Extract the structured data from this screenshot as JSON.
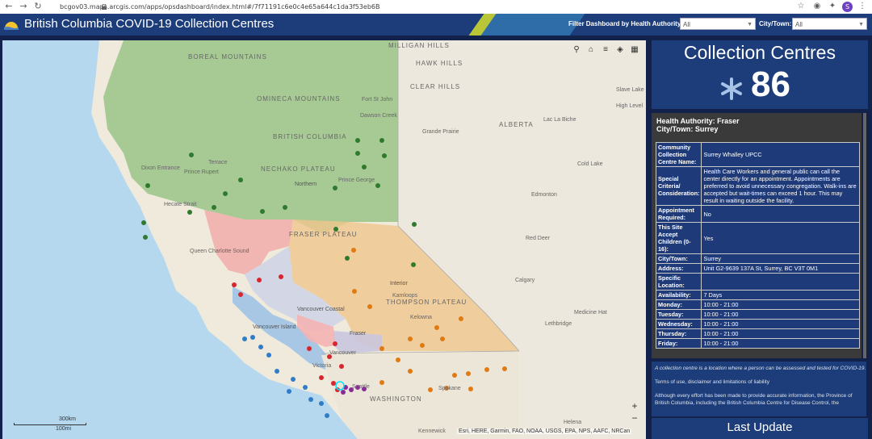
{
  "browser": {
    "url": "bcgov03.maps.arcgis.com/apps/opsdashboard/index.html#/7f71191c6e0c4e65a644c1da3f53eb6B",
    "profile_initial": "S"
  },
  "header": {
    "title": "British Columbia COVID-19 Collection Centres",
    "filter_label": "Filter Dashboard by Health Authority:",
    "filter_value": "All",
    "city_label": "City/Town:",
    "city_value": "All"
  },
  "map": {
    "labels": [
      "BOREAL MOUNTAINS",
      "OMINECA MOUNTAINS",
      "BRITISH COLUMBIA",
      "NECHAKO PLATEAU",
      "FRASER PLATEAU",
      "THOMPSON PLATEAU",
      "Vancouver Coastal",
      "Vancouver Island",
      "Fraser",
      "Interior",
      "Northern",
      "Fort St John",
      "Dawson Creek",
      "Prince George",
      "Terrace",
      "Prince Rupert",
      "Dixon Entrance",
      "Hecate Strait",
      "Queen Charlotte Sound",
      "Grande Prairie",
      "ALBERTA",
      "Edmonton",
      "Red Deer",
      "Calgary",
      "Lethbridge",
      "Medicine Hat",
      "Kamloops",
      "Kelowna",
      "Vancouver",
      "Victoria",
      "Seattle",
      "Spokane",
      "WASHINGTON",
      "Cold Lake",
      "Lac La Biche",
      "Slave Lake",
      "High Level",
      "Kennewick",
      "Helena",
      "CLEAR HILLS",
      "HAWK HILLS",
      "MILLIGAN HILLS"
    ],
    "attribution": "Esri, HERE, Garmin, FAO, NOAA, USGS, EPA, NPS, AAFC, NRCan",
    "scale_km": "300km",
    "scale_mi": "100mi",
    "tools": [
      "search-icon",
      "home-icon",
      "list-icon",
      "layers-icon",
      "grid-icon"
    ]
  },
  "kpi": {
    "title": "Collection Centres",
    "value": "86",
    "icon": "asterisk-icon"
  },
  "details": {
    "health_authority": "Health Authority: Fraser",
    "city_town": "City/Town: Surrey",
    "rows": [
      {
        "key": "Community Collection Centre Name:",
        "value": "Surrey Whalley UPCC"
      },
      {
        "key": "Special Criteria/ Consideration:",
        "value": "Health Care Workers and general public can call the center directly for an appointment. Appointments are preferred to avoid unnecessary congregation. Walk-ins are accepted but wait-times can exceed 1 hour. This may result in waiting outside the facility."
      },
      {
        "key": "Appointment Required:",
        "value": "No"
      },
      {
        "key": "This Site Accept Children (0-16):",
        "value": "Yes"
      },
      {
        "key": "City/Town:",
        "value": "Surrey"
      },
      {
        "key": "Address:",
        "value": "Unit G2-9639 137A St, Surrey, BC V3T 0M1"
      },
      {
        "key": "Specific Location:",
        "value": ""
      },
      {
        "key": "Availability:",
        "value": "7 Days"
      },
      {
        "key": "Monday:",
        "value": "10:00 - 21:00"
      },
      {
        "key": "Tuesday:",
        "value": "10:00 - 21:00"
      },
      {
        "key": "Wednesday:",
        "value": "10:00 - 21:00"
      },
      {
        "key": "Thursday:",
        "value": "10:00 - 21:00"
      },
      {
        "key": "Friday:",
        "value": "10:00 - 21:00"
      }
    ]
  },
  "info": {
    "definition": "A collection centre is a location where a person can be assessed and tested for COVID-19.",
    "terms": "Terms of use, disclaimer and limitations of liability",
    "disclaimer": "Although every effort has been made to provide accurate information, the Province of British Columbia, including the British Columbia Centre for Disease Control, the"
  },
  "last_update": {
    "title": "Last Update"
  },
  "colors": {
    "header": "#1c3d7a",
    "northern": "#2f7a2f",
    "interior": "#e07a12",
    "vancouver_coastal": "#d8262e",
    "vancouver_island": "#2f7cc7",
    "fraser": "#8a2a9a"
  }
}
